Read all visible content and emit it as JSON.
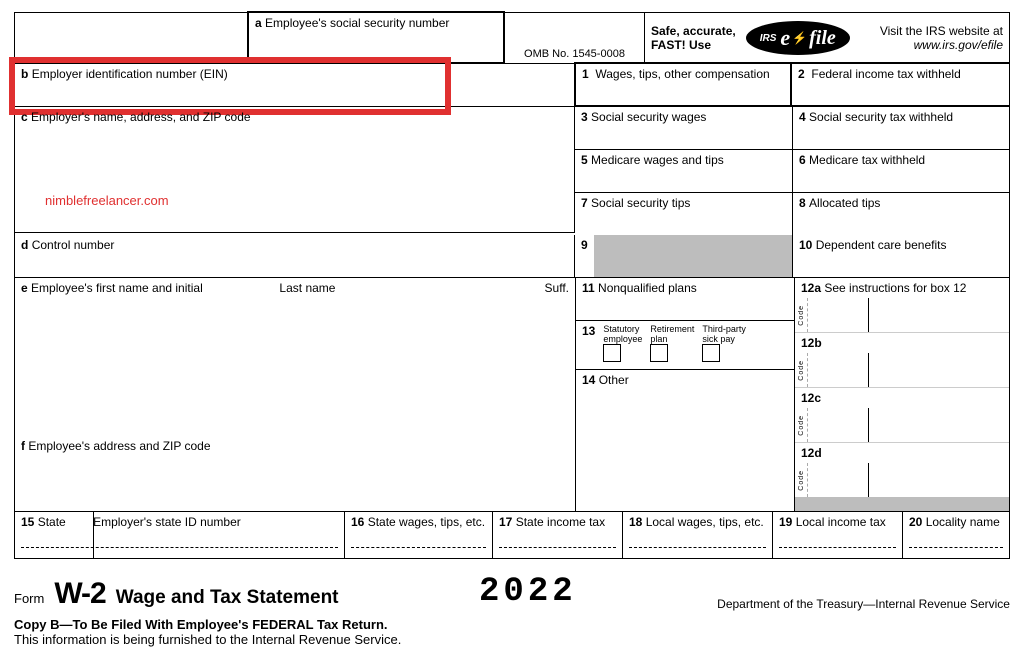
{
  "top": {
    "a": {
      "num": "a",
      "label": "Employee's social security number"
    },
    "omb": "OMB No. 1545-0008",
    "safe1": "Safe, accurate,",
    "safe2": "FAST! Use",
    "visit1": "Visit the IRS website at",
    "visit2": "www.irs.gov/efile",
    "efile": {
      "irs": "IRS",
      "e": "e",
      "file": "file"
    }
  },
  "b": {
    "num": "b",
    "label": "Employer identification number (EIN)"
  },
  "c": {
    "num": "c",
    "label": "Employer's name, address, and ZIP code"
  },
  "watermark": "nimblefreelancer.com",
  "d": {
    "num": "d",
    "label": "Control number"
  },
  "e": {
    "num": "e",
    "label": "Employee's first name and initial",
    "last": "Last name",
    "suff": "Suff."
  },
  "f": {
    "num": "f",
    "label": "Employee's address and ZIP code"
  },
  "box1": {
    "num": "1",
    "label": "Wages, tips, other compensation"
  },
  "box2": {
    "num": "2",
    "label": "Federal income tax withheld"
  },
  "box3": {
    "num": "3",
    "label": "Social security wages"
  },
  "box4": {
    "num": "4",
    "label": "Social security tax withheld"
  },
  "box5": {
    "num": "5",
    "label": "Medicare wages and tips"
  },
  "box6": {
    "num": "6",
    "label": "Medicare tax withheld"
  },
  "box7": {
    "num": "7",
    "label": "Social security tips"
  },
  "box8": {
    "num": "8",
    "label": "Allocated tips"
  },
  "box9": {
    "num": "9"
  },
  "box10": {
    "num": "10",
    "label": "Dependent care benefits"
  },
  "box11": {
    "num": "11",
    "label": "Nonqualified plans"
  },
  "box12a": {
    "num": "12a",
    "label": "See instructions for box 12",
    "code": "Code"
  },
  "box12b": {
    "num": "12b",
    "code": "Code"
  },
  "box12c": {
    "num": "12c",
    "code": "Code"
  },
  "box12d": {
    "num": "12d",
    "code": "Code"
  },
  "box13": {
    "num": "13",
    "a": "Statutory",
    "a2": "employee",
    "b": "Retirement",
    "b2": "plan",
    "c": "Third-party",
    "c2": "sick pay"
  },
  "box14": {
    "num": "14",
    "label": "Other"
  },
  "box15": {
    "num": "15",
    "a": "State",
    "b": "Employer's state ID number"
  },
  "box16": {
    "num": "16",
    "label": "State wages, tips, etc."
  },
  "box17": {
    "num": "17",
    "label": "State income tax"
  },
  "box18": {
    "num": "18",
    "label": "Local wages, tips, etc."
  },
  "box19": {
    "num": "19",
    "label": "Local income tax"
  },
  "box20": {
    "num": "20",
    "label": "Locality name"
  },
  "footer": {
    "form": "Form",
    "w2": "W-2",
    "wts": "Wage and Tax Statement",
    "year": "2022",
    "dept": "Department of the Treasury—Internal Revenue Service",
    "copyb": "Copy B—To Be Filed With Employee's FEDERAL Tax Return.",
    "info": "This information is being furnished to the Internal Revenue Service."
  }
}
